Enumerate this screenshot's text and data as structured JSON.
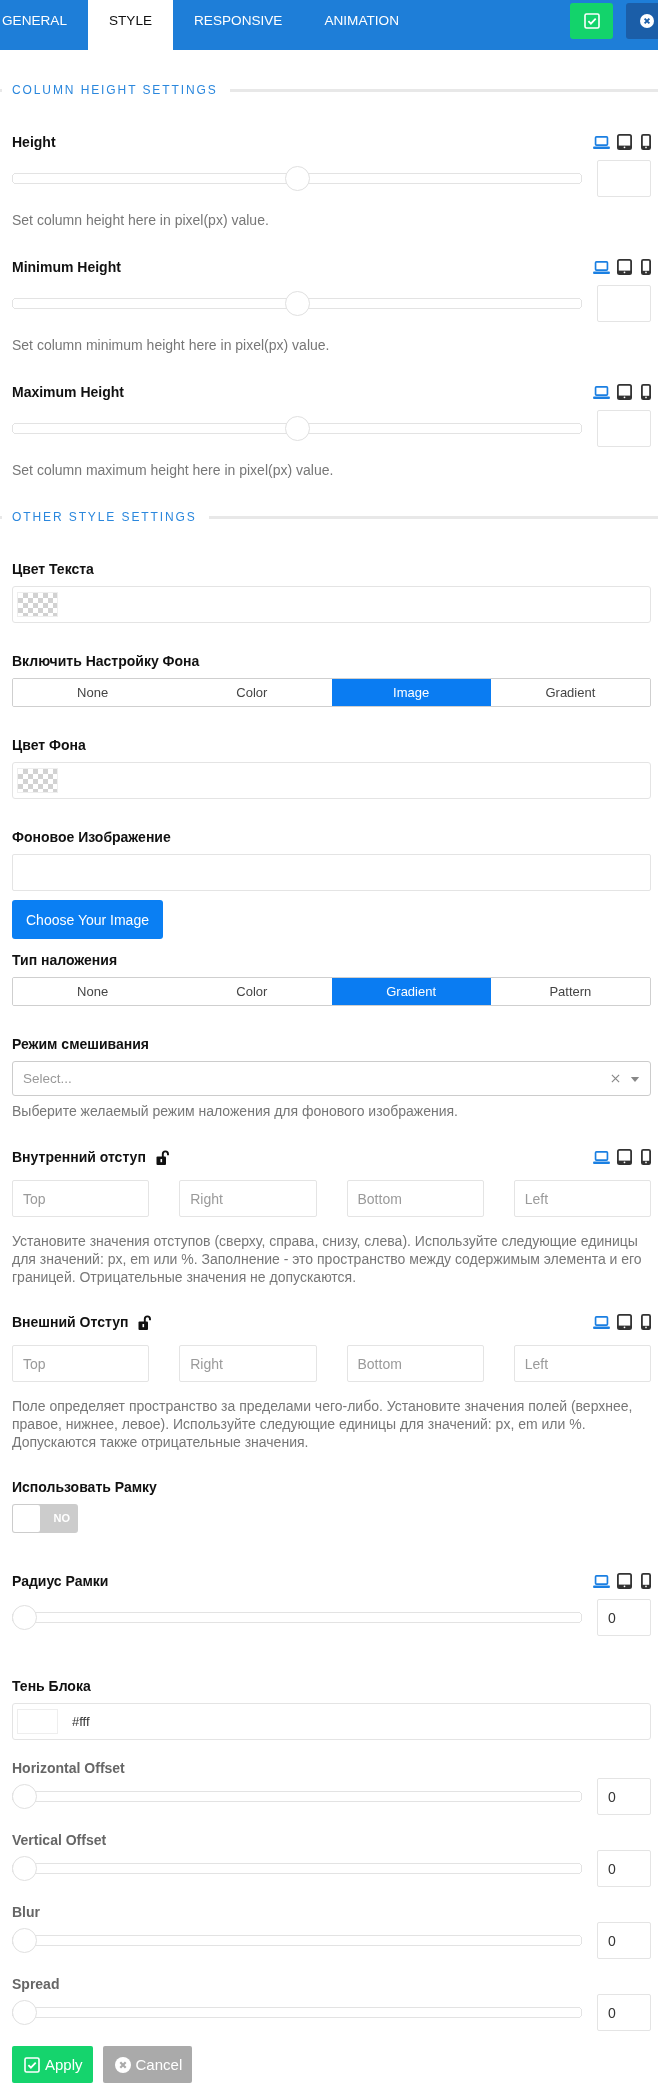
{
  "tabs": [
    {
      "label": "GENERAL",
      "selected": false
    },
    {
      "label": "STYLE",
      "selected": true
    },
    {
      "label": "RESPONSIVE",
      "selected": false
    },
    {
      "label": "ANIMATION",
      "selected": false
    }
  ],
  "sections": [
    {
      "title": "COLUMN HEIGHT SETTINGS",
      "fields": [
        {
          "kind": "slider",
          "label": "Height",
          "devices": [
            {
              "kind": "desktop",
              "selected": true
            },
            {
              "kind": "tablet",
              "selected": false
            },
            {
              "kind": "mobile",
              "selected": false
            }
          ],
          "level": 0.5,
          "help": "Set column height here in pixel(px) value."
        },
        {
          "kind": "slider",
          "label": "Minimum Height",
          "devices": [
            {
              "kind": "desktop",
              "selected": true
            },
            {
              "kind": "tablet",
              "selected": false
            },
            {
              "kind": "mobile",
              "selected": false
            }
          ],
          "level": 0.5,
          "help": "Set column minimum height here in pixel(px) value."
        },
        {
          "kind": "slider",
          "label": "Maximum Height",
          "devices": [
            {
              "kind": "desktop",
              "selected": true
            },
            {
              "kind": "tablet",
              "selected": false
            },
            {
              "kind": "mobile",
              "selected": false
            }
          ],
          "level": 0.5,
          "help": "Set column maximum height here in pixel(px) value."
        }
      ]
    },
    {
      "title": "OTHER STYLE SETTINGS",
      "fields": [
        {
          "kind": "color",
          "label": "Цвет Текста"
        },
        {
          "kind": "segmented",
          "label": "Включить Настройку Фона",
          "options": [
            {
              "label": "None",
              "selected": false
            },
            {
              "label": "Color",
              "selected": false
            },
            {
              "label": "Image",
              "selected": true
            },
            {
              "label": "Gradient",
              "selected": false
            }
          ]
        },
        {
          "kind": "color",
          "label": "Цвет Фона"
        },
        {
          "kind": "image",
          "label": "Фоновое Изображение",
          "button": "Choose Your Image"
        },
        {
          "kind": "segmented",
          "label": "Тип наложения",
          "options": [
            {
              "label": "None",
              "selected": false
            },
            {
              "label": "Color",
              "selected": false
            },
            {
              "label": "Gradient",
              "selected": true
            },
            {
              "label": "Pattern",
              "selected": false
            }
          ]
        },
        {
          "kind": "select",
          "label": "Режим смешивания",
          "placeholder": "Select...",
          "help": "Выберите желаемый режим наложения для фонового изображения."
        },
        {
          "kind": "spacing",
          "label": "Внутренний отступ",
          "locked": false,
          "devices": [
            {
              "kind": "desktop",
              "selected": true
            },
            {
              "kind": "tablet",
              "selected": false
            },
            {
              "kind": "mobile",
              "selected": false
            }
          ],
          "inputs": [
            {
              "placeholder": "Top"
            },
            {
              "placeholder": "Right"
            },
            {
              "placeholder": "Bottom"
            },
            {
              "placeholder": "Left"
            }
          ],
          "help": "Установите значения отступов (сверху, справа, снизу, слева). Используйте следующие единицы для значений: px, em или %. Заполнение - это пространство между содержимым элемента и его границей. Отрицательные значения не допускаются."
        },
        {
          "kind": "spacing",
          "label": "Внешний Отступ",
          "locked": false,
          "devices": [
            {
              "kind": "desktop",
              "selected": true
            },
            {
              "kind": "tablet",
              "selected": false
            },
            {
              "kind": "mobile",
              "selected": false
            }
          ],
          "inputs": [
            {
              "placeholder": "Top"
            },
            {
              "placeholder": "Right"
            },
            {
              "placeholder": "Bottom"
            },
            {
              "placeholder": "Left"
            }
          ],
          "help": "Поле определяет пространство за пределами чего-либо. Установите значения полей (верхнее, правое, нижнее, левое). Используйте следующие единицы для значений: px, em или %. Допускаются также отрицательные значения."
        },
        {
          "kind": "toggle",
          "label": "Использовать Рамку",
          "on": false,
          "state_text": "NO"
        },
        {
          "kind": "slider",
          "label": "Радиус Рамки",
          "devices": [
            {
              "kind": "desktop",
              "selected": true
            },
            {
              "kind": "tablet",
              "selected": false
            },
            {
              "kind": "mobile",
              "selected": false
            }
          ],
          "level": 0,
          "value": "0"
        },
        {
          "kind": "color",
          "label": "Тень Блока",
          "value": "#fff"
        },
        {
          "kind": "subslider",
          "label": "Horizontal Offset",
          "level": 0,
          "value": "0"
        },
        {
          "kind": "subslider",
          "label": "Vertical Offset",
          "level": 0,
          "value": "0"
        },
        {
          "kind": "subslider",
          "label": "Blur",
          "level": 0,
          "value": "0"
        },
        {
          "kind": "subslider",
          "label": "Spread",
          "level": 0,
          "value": "0"
        }
      ]
    }
  ],
  "footer": [
    {
      "kind": "apply",
      "label": "Apply"
    },
    {
      "kind": "cancel",
      "label": "Cancel"
    }
  ]
}
